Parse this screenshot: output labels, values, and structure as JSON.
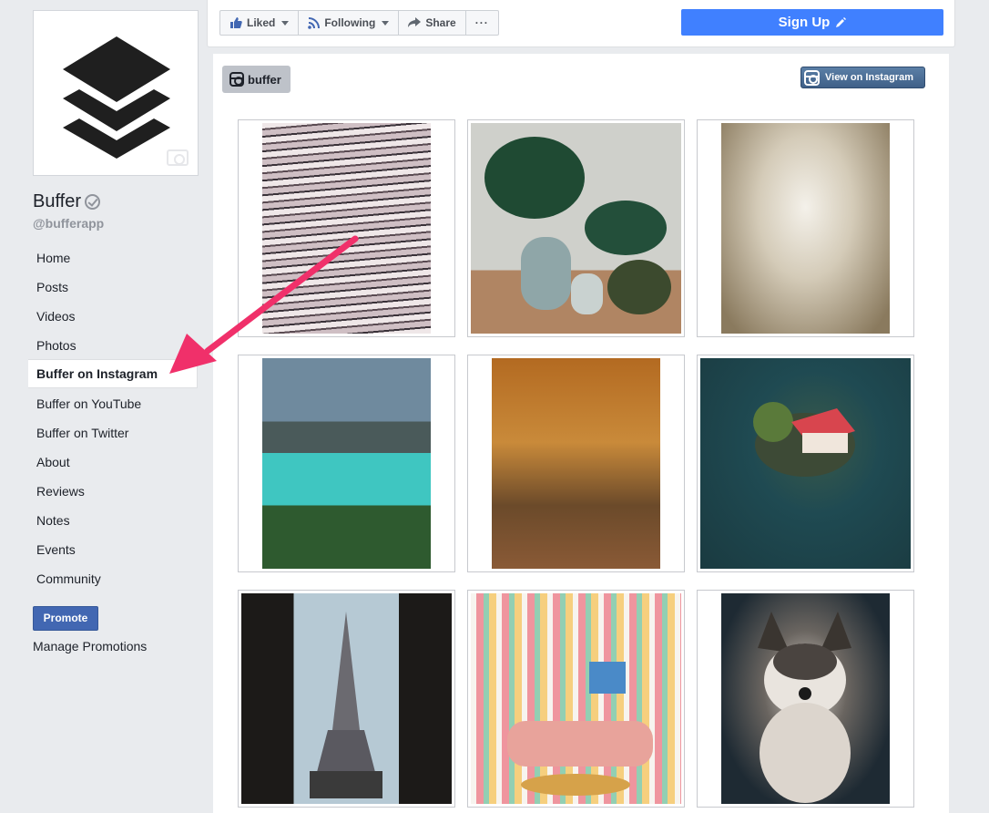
{
  "page": {
    "name": "Buffer",
    "handle": "@bufferapp"
  },
  "nav": {
    "items": [
      {
        "label": "Home"
      },
      {
        "label": "Posts"
      },
      {
        "label": "Videos"
      },
      {
        "label": "Photos"
      },
      {
        "label": "Buffer on Instagram",
        "active": true
      },
      {
        "label": "Buffer on YouTube"
      },
      {
        "label": "Buffer on Twitter"
      },
      {
        "label": "About"
      },
      {
        "label": "Reviews"
      },
      {
        "label": "Notes"
      },
      {
        "label": "Events"
      },
      {
        "label": "Community"
      }
    ],
    "promote_label": "Promote",
    "manage_label": "Manage Promotions"
  },
  "actions": {
    "liked": "Liked",
    "following": "Following",
    "share": "Share",
    "more": "···",
    "signup": "Sign Up"
  },
  "instagram": {
    "account_tag": "buffer",
    "view_label": "View on Instagram",
    "photos": [
      {
        "icon": "library-photo"
      },
      {
        "icon": "plant-photo"
      },
      {
        "icon": "horses-photo"
      },
      {
        "icon": "lake-photo"
      },
      {
        "icon": "autumn-park-photo"
      },
      {
        "icon": "island-house-photo"
      },
      {
        "icon": "eiffel-tower-photo"
      },
      {
        "icon": "bookshelf-photo"
      },
      {
        "icon": "husky-photo"
      }
    ]
  },
  "colors": {
    "accent": "#4267b2",
    "signup": "#4080ff",
    "annotation_arrow": "#f0306a"
  }
}
